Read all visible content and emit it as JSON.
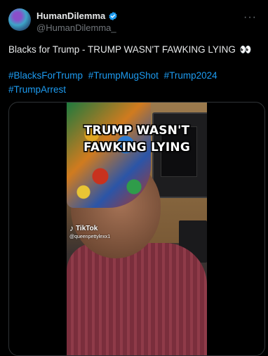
{
  "author": {
    "display_name": "HumanDilemma",
    "handle": "@HumanDilemma_",
    "verified": true,
    "avatar_icon": "avatar-gradient-icon"
  },
  "menu": {
    "more_label": "···"
  },
  "tweet": {
    "text": "Blacks for Trump - TRUMP WASN'T FAWKING LYING",
    "emoji": "👀",
    "hashtags": [
      "#BlacksForTrump",
      "#TrumpMugShot",
      "#Trump2024",
      "#TrumpArrest"
    ]
  },
  "media": {
    "caption_line1": "TRUMP WASN'T",
    "caption_line2": "FAWKING LYING",
    "watermark_brand": "TikTok",
    "watermark_user": "@queenpettylexx1"
  },
  "colors": {
    "background": "#000000",
    "link": "#1d9bf0",
    "verified": "#1d9bf0",
    "secondary_text": "#71767b"
  }
}
